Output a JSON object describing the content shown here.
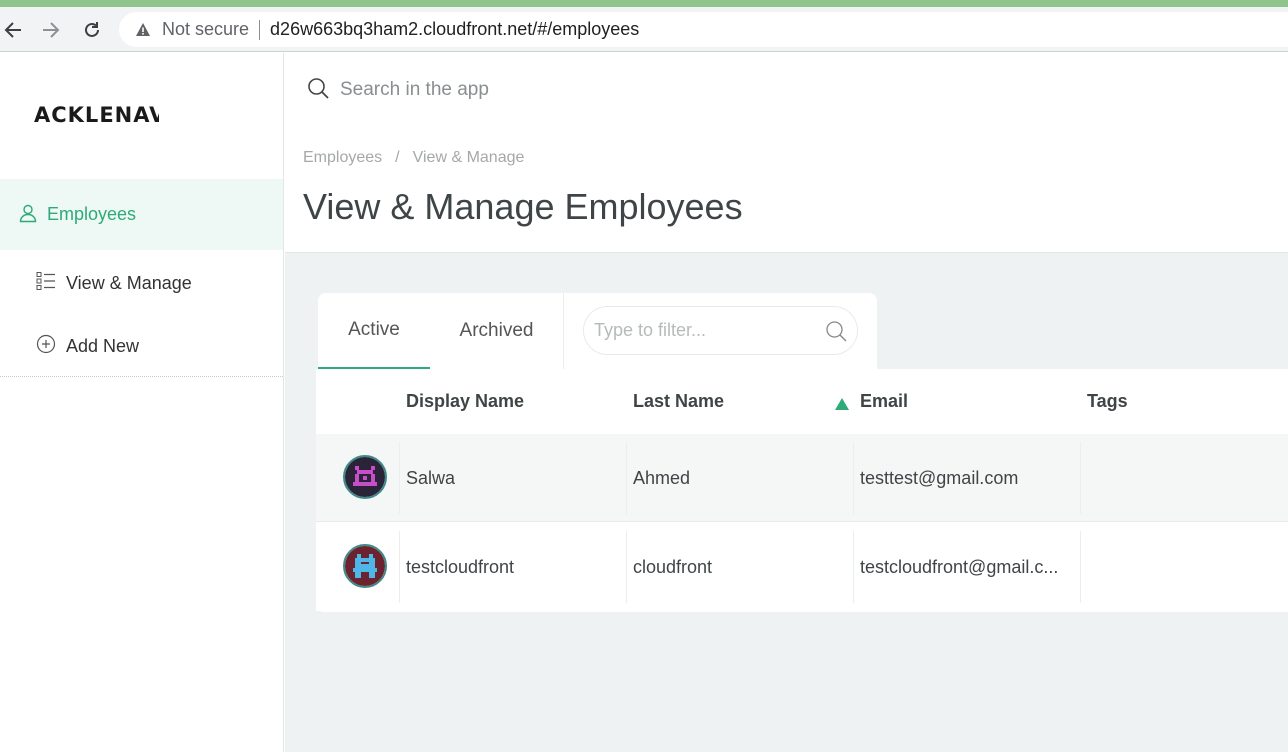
{
  "browser": {
    "security_label": "Not secure",
    "url": "d26w663bq3ham2.cloudfront.net/#/employees",
    "icons": {
      "back": "arrow-left-icon",
      "forward": "arrow-right-icon",
      "reload": "reload-icon",
      "warning": "warning-triangle-icon"
    }
  },
  "sidebar": {
    "logo": "ACKLENAV",
    "section": {
      "label": "Employees",
      "icon": "user-icon"
    },
    "items": [
      {
        "label": "View & Manage",
        "icon": "list-icon"
      },
      {
        "label": "Add New",
        "icon": "plus-circle-icon"
      }
    ]
  },
  "header": {
    "search_placeholder": "Search in the app",
    "breadcrumb": [
      "Employees",
      "View & Manage"
    ],
    "breadcrumb_separator": "/",
    "title": "View & Manage Employees"
  },
  "tabs": {
    "items": [
      "Active",
      "Archived"
    ],
    "active": "Active",
    "filter_placeholder": "Type to filter..."
  },
  "table": {
    "columns": [
      "Display Name",
      "Last Name",
      "Email",
      "Tags"
    ],
    "sorted_column": "Email",
    "sort_direction": "ascending",
    "rows": [
      {
        "display_name": "Salwa",
        "last_name": "Ahmed",
        "email": "testtest@gmail.com",
        "tags": ""
      },
      {
        "display_name": "testcloudfront",
        "last_name": "cloudfront",
        "email": "testcloudfront@gmail.c...",
        "tags": ""
      }
    ]
  },
  "colors": {
    "accent": "#2eaa78",
    "sidebar_active_bg": "#eef8f4",
    "main_bg": "#eff2f2",
    "chrome_strip": "#8fc48c"
  }
}
